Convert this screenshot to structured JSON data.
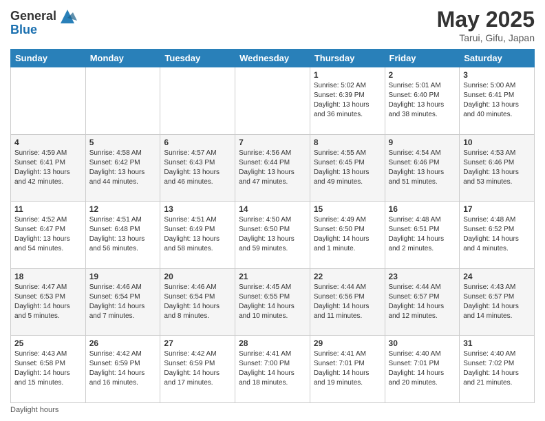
{
  "header": {
    "logo_general": "General",
    "logo_blue": "Blue",
    "title": "May 2025",
    "location": "Tarui, Gifu, Japan"
  },
  "days_of_week": [
    "Sunday",
    "Monday",
    "Tuesday",
    "Wednesday",
    "Thursday",
    "Friday",
    "Saturday"
  ],
  "weeks": [
    [
      {
        "day": "",
        "info": ""
      },
      {
        "day": "",
        "info": ""
      },
      {
        "day": "",
        "info": ""
      },
      {
        "day": "",
        "info": ""
      },
      {
        "day": "1",
        "info": "Sunrise: 5:02 AM\nSunset: 6:39 PM\nDaylight: 13 hours\nand 36 minutes."
      },
      {
        "day": "2",
        "info": "Sunrise: 5:01 AM\nSunset: 6:40 PM\nDaylight: 13 hours\nand 38 minutes."
      },
      {
        "day": "3",
        "info": "Sunrise: 5:00 AM\nSunset: 6:41 PM\nDaylight: 13 hours\nand 40 minutes."
      }
    ],
    [
      {
        "day": "4",
        "info": "Sunrise: 4:59 AM\nSunset: 6:41 PM\nDaylight: 13 hours\nand 42 minutes."
      },
      {
        "day": "5",
        "info": "Sunrise: 4:58 AM\nSunset: 6:42 PM\nDaylight: 13 hours\nand 44 minutes."
      },
      {
        "day": "6",
        "info": "Sunrise: 4:57 AM\nSunset: 6:43 PM\nDaylight: 13 hours\nand 46 minutes."
      },
      {
        "day": "7",
        "info": "Sunrise: 4:56 AM\nSunset: 6:44 PM\nDaylight: 13 hours\nand 47 minutes."
      },
      {
        "day": "8",
        "info": "Sunrise: 4:55 AM\nSunset: 6:45 PM\nDaylight: 13 hours\nand 49 minutes."
      },
      {
        "day": "9",
        "info": "Sunrise: 4:54 AM\nSunset: 6:46 PM\nDaylight: 13 hours\nand 51 minutes."
      },
      {
        "day": "10",
        "info": "Sunrise: 4:53 AM\nSunset: 6:46 PM\nDaylight: 13 hours\nand 53 minutes."
      }
    ],
    [
      {
        "day": "11",
        "info": "Sunrise: 4:52 AM\nSunset: 6:47 PM\nDaylight: 13 hours\nand 54 minutes."
      },
      {
        "day": "12",
        "info": "Sunrise: 4:51 AM\nSunset: 6:48 PM\nDaylight: 13 hours\nand 56 minutes."
      },
      {
        "day": "13",
        "info": "Sunrise: 4:51 AM\nSunset: 6:49 PM\nDaylight: 13 hours\nand 58 minutes."
      },
      {
        "day": "14",
        "info": "Sunrise: 4:50 AM\nSunset: 6:50 PM\nDaylight: 13 hours\nand 59 minutes."
      },
      {
        "day": "15",
        "info": "Sunrise: 4:49 AM\nSunset: 6:50 PM\nDaylight: 14 hours\nand 1 minute."
      },
      {
        "day": "16",
        "info": "Sunrise: 4:48 AM\nSunset: 6:51 PM\nDaylight: 14 hours\nand 2 minutes."
      },
      {
        "day": "17",
        "info": "Sunrise: 4:48 AM\nSunset: 6:52 PM\nDaylight: 14 hours\nand 4 minutes."
      }
    ],
    [
      {
        "day": "18",
        "info": "Sunrise: 4:47 AM\nSunset: 6:53 PM\nDaylight: 14 hours\nand 5 minutes."
      },
      {
        "day": "19",
        "info": "Sunrise: 4:46 AM\nSunset: 6:54 PM\nDaylight: 14 hours\nand 7 minutes."
      },
      {
        "day": "20",
        "info": "Sunrise: 4:46 AM\nSunset: 6:54 PM\nDaylight: 14 hours\nand 8 minutes."
      },
      {
        "day": "21",
        "info": "Sunrise: 4:45 AM\nSunset: 6:55 PM\nDaylight: 14 hours\nand 10 minutes."
      },
      {
        "day": "22",
        "info": "Sunrise: 4:44 AM\nSunset: 6:56 PM\nDaylight: 14 hours\nand 11 minutes."
      },
      {
        "day": "23",
        "info": "Sunrise: 4:44 AM\nSunset: 6:57 PM\nDaylight: 14 hours\nand 12 minutes."
      },
      {
        "day": "24",
        "info": "Sunrise: 4:43 AM\nSunset: 6:57 PM\nDaylight: 14 hours\nand 14 minutes."
      }
    ],
    [
      {
        "day": "25",
        "info": "Sunrise: 4:43 AM\nSunset: 6:58 PM\nDaylight: 14 hours\nand 15 minutes."
      },
      {
        "day": "26",
        "info": "Sunrise: 4:42 AM\nSunset: 6:59 PM\nDaylight: 14 hours\nand 16 minutes."
      },
      {
        "day": "27",
        "info": "Sunrise: 4:42 AM\nSunset: 6:59 PM\nDaylight: 14 hours\nand 17 minutes."
      },
      {
        "day": "28",
        "info": "Sunrise: 4:41 AM\nSunset: 7:00 PM\nDaylight: 14 hours\nand 18 minutes."
      },
      {
        "day": "29",
        "info": "Sunrise: 4:41 AM\nSunset: 7:01 PM\nDaylight: 14 hours\nand 19 minutes."
      },
      {
        "day": "30",
        "info": "Sunrise: 4:40 AM\nSunset: 7:01 PM\nDaylight: 14 hours\nand 20 minutes."
      },
      {
        "day": "31",
        "info": "Sunrise: 4:40 AM\nSunset: 7:02 PM\nDaylight: 14 hours\nand 21 minutes."
      }
    ]
  ],
  "footer": {
    "note": "Daylight hours"
  }
}
